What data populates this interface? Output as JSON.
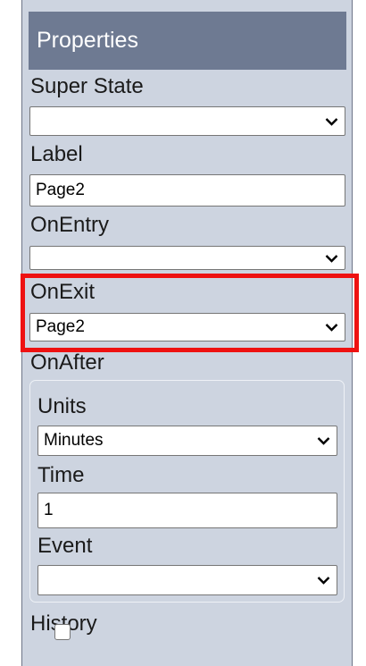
{
  "panel": {
    "title": "Properties"
  },
  "fields": {
    "super_state": {
      "label": "Super State",
      "value": ""
    },
    "label": {
      "label": "Label",
      "value": "Page2"
    },
    "on_entry": {
      "label": "OnEntry",
      "value": ""
    },
    "on_exit": {
      "label": "OnExit",
      "value": "Page2"
    },
    "on_after": {
      "label": "OnAfter",
      "units": {
        "label": "Units",
        "value": "Minutes"
      },
      "time": {
        "label": "Time",
        "value": "1"
      },
      "event": {
        "label": "Event",
        "value": ""
      }
    },
    "history": {
      "label": "History",
      "checked": false
    }
  },
  "colors": {
    "header_bg": "#6e7a92",
    "panel_bg": "#cdd4e0",
    "highlight": "#ee1111"
  },
  "icons": {
    "dropdown": "chevron-down-icon"
  }
}
